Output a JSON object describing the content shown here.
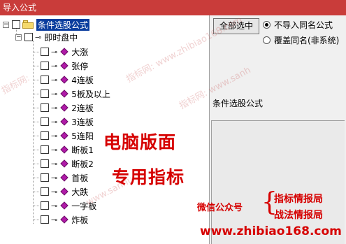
{
  "window": {
    "title": "导入公式"
  },
  "tree": {
    "root_label": "条件选股公式",
    "group_label": "即时盘中",
    "items": [
      "大涨",
      "张停",
      "4连板",
      "5板及以上",
      "2连板",
      "3连板",
      "5连阳",
      "断板1",
      "断板2",
      "首板",
      "大跌",
      "一字板",
      "炸板"
    ]
  },
  "panel": {
    "select_all_label": "全部选中",
    "radio_no_import": "不导入同名公式",
    "radio_overwrite": "覆盖同名(非系统)",
    "formula_label": "条件选股公式"
  },
  "overlay": {
    "line1": "电脑版面",
    "line2": "专用指标",
    "wechat_label": "微信公众号",
    "account1": "指标情报局",
    "account2": "战法情报局",
    "url": "www.zhibiao168.com"
  },
  "watermarks": [
    "指标网: www.zhibiao168.com",
    "www.sanhu",
    "指标网:",
    "指标网: www.sanh"
  ],
  "colors": {
    "title_bar": "#c93c3a",
    "selection": "#0a3d9e",
    "diamond": "#b01aa8",
    "promo": "#d60000"
  }
}
